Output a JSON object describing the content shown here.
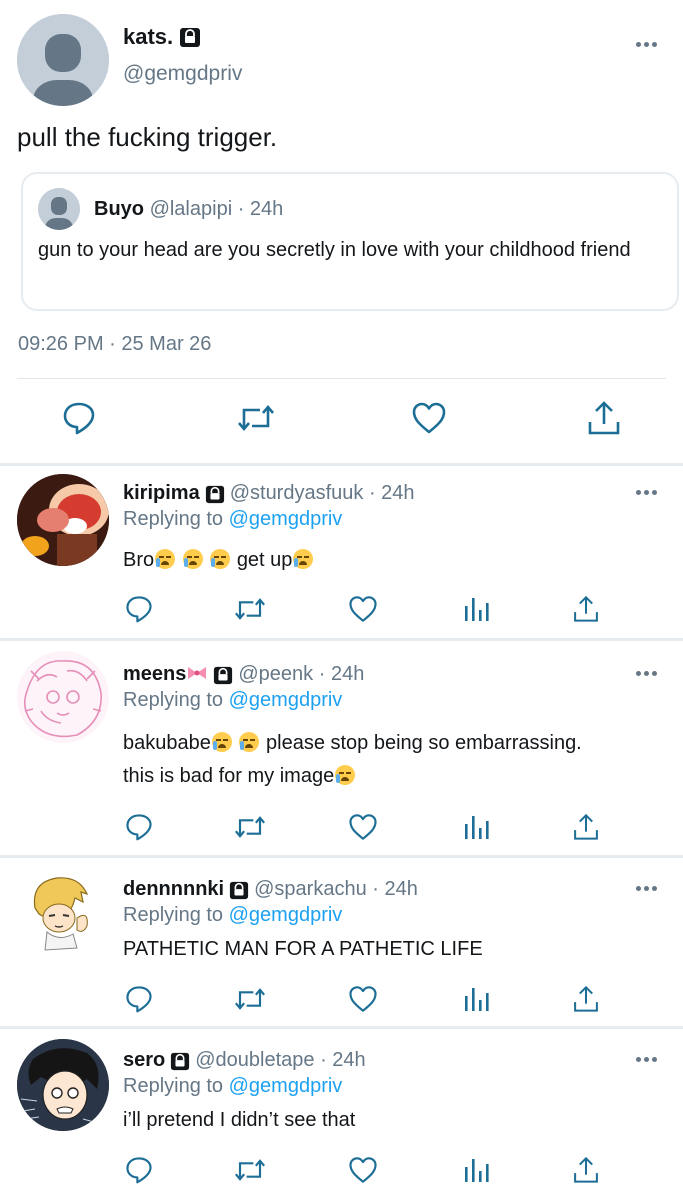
{
  "main_tweet": {
    "display_name": "kats.",
    "handle": "@gemgdpriv",
    "text": "pull the fucking trigger.",
    "quote": {
      "display_name": "Buyo",
      "handle_time": "@lalapipi · 24h",
      "text": "gun to your head are you secretly in love with your childhood friend"
    },
    "timestamp": "09:26 PM · 25 Mar 26"
  },
  "replies": [
    {
      "display_name": "kiripima",
      "meta": "@sturdyasfuuk · 24h",
      "replying_prefix": "Replying to",
      "mention": "@gemgdpriv",
      "text_a": "Bro",
      "text_b": " get up",
      "text_c": ""
    },
    {
      "display_name": "meens",
      "meta": "@peenk · 24h",
      "replying_prefix": "Replying to",
      "mention": "@gemgdpriv",
      "text_a": "bakubabe",
      "text_b": " please stop being so embarrassing.",
      "text_c": "this is bad for my image"
    },
    {
      "display_name": "dennnnnki",
      "meta": "@sparkachu · 24h",
      "replying_prefix": "Replying to",
      "mention": "@gemgdpriv",
      "text_a": "PATHETIC MAN FOR A PATHETIC LIFE",
      "text_b": "",
      "text_c": ""
    },
    {
      "display_name": "sero",
      "meta": "@doubletape · 24h",
      "replying_prefix": "Replying to",
      "mention": "@gemgdpriv",
      "text_a": "i’ll pretend I didn’t see that",
      "text_b": "",
      "text_c": ""
    }
  ],
  "colors": {
    "link": "#1da1f2",
    "secondary_text": "#657786",
    "separator": "#e6ecf0",
    "icon": "#1d6e96"
  },
  "icons": [
    "lock-icon",
    "more-icon",
    "reply-icon",
    "retweet-icon",
    "like-icon",
    "share-icon",
    "analytics-icon",
    "loudly-crying-face-emoji",
    "ribbon-emoji"
  ]
}
